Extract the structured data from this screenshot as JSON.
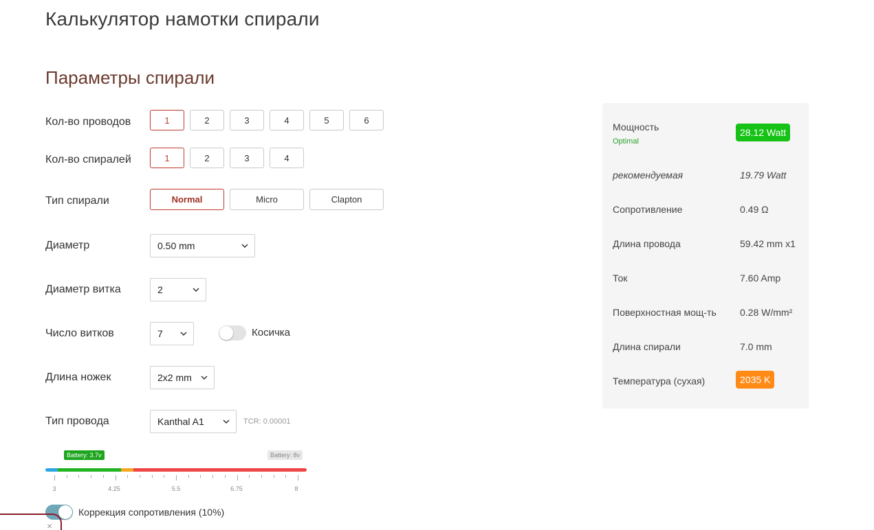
{
  "page_title": "Калькулятор намотки спирали",
  "section_title": "Параметры спирали",
  "wires": {
    "label": "Кол-во проводов",
    "options": [
      "1",
      "2",
      "3",
      "4",
      "5",
      "6"
    ],
    "selected": "1"
  },
  "coils": {
    "label": "Кол-во спиралей",
    "options": [
      "1",
      "2",
      "3",
      "4"
    ],
    "selected": "1"
  },
  "coil_type": {
    "label": "Тип спирали",
    "options": [
      "Normal",
      "Micro",
      "Clapton"
    ],
    "selected": "Normal"
  },
  "diameter": {
    "label": "Диаметр",
    "value": "0.50 mm"
  },
  "inner_diameter": {
    "label": "Диаметр витка",
    "value": "2"
  },
  "wraps": {
    "label": "Число витков",
    "value": "7",
    "braid_label": "Косичка",
    "braid_on": false
  },
  "legs": {
    "label": "Длина ножек",
    "value": "2x2 mm"
  },
  "wire_type": {
    "label": "Тип провода",
    "value": "Kanthal A1",
    "tcr": "TCR: 0.00001"
  },
  "battery": {
    "current_label": "Battery: 3.7v",
    "max_label": "Battery: 8v",
    "current_value": 3.7,
    "range": [
      3,
      8
    ],
    "tick_labels": [
      "3",
      "4.25",
      "5.5",
      "6.75",
      "8"
    ]
  },
  "resistance_correction": {
    "label": "Коррекция сопротивления (10%)",
    "on": true
  },
  "close_glyph": "×",
  "results": {
    "power_label": "Мощность",
    "power_status": "Optimal",
    "power_value": "28.12 Watt",
    "recommended_label": "рекомендуемая",
    "recommended_value": "19.79 Watt",
    "resistance_label": "Сопротивление",
    "resistance_value": "0.49 Ω",
    "wire_length_label": "Длина провода",
    "wire_length_value": "59.42 mm x1",
    "current_label": "Ток",
    "current_value": "7.60 Amp",
    "heat_flux_label": "Поверхностная мощ-ть",
    "heat_flux_value": "0.28 W/mm²",
    "coil_length_label": "Длина спирали",
    "coil_length_value": "7.0 mm",
    "temperature_label": "Температура (сухая)",
    "temperature_value": "2035 K"
  },
  "colors": {
    "accent": "#c0392b",
    "power_badge": "#15c215",
    "temperature_badge": "#ff8a16",
    "toggle_on": "#6fa7b8"
  }
}
